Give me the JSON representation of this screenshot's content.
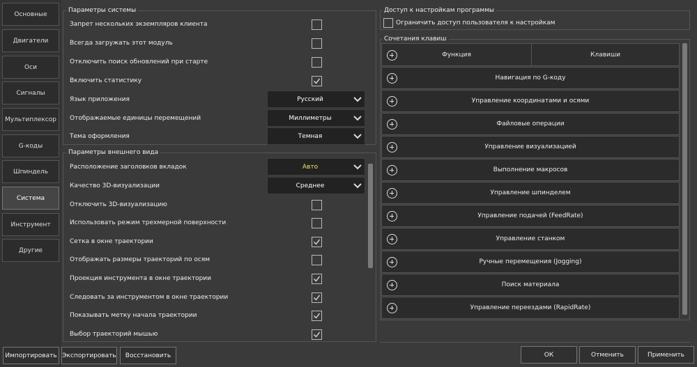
{
  "sidebar": {
    "tabs": [
      "Основные",
      "Двигатели",
      "Оси",
      "Сигналы",
      "Мультиплексор",
      "G-коды",
      "Шпиндель",
      "Система",
      "Инструмент",
      "Другие"
    ],
    "active": "Система"
  },
  "system_params": {
    "title": "Параметры системы",
    "rows": [
      {
        "label": "Запрет нескольких экземпляров клиента",
        "checked": false
      },
      {
        "label": "Всегда загружать этот модуль",
        "checked": false
      },
      {
        "label": "Отключить поиск обновлений при старте",
        "checked": false
      },
      {
        "label": "Включить статистику",
        "checked": true
      }
    ],
    "dropdowns": [
      {
        "label": "Язык приложения",
        "value": "Русский"
      },
      {
        "label": "Отображаемые единицы перемещений",
        "value": "Миллиметры"
      },
      {
        "label": "Тема оформления",
        "value": "Темная"
      }
    ]
  },
  "appearance": {
    "title": "Параметры внешнего вида",
    "dropdowns": [
      {
        "label": "Расположение заголовков вкладок",
        "value": "Авто"
      },
      {
        "label": "Качество 3D-визуализации",
        "value": "Среднее"
      }
    ],
    "rows": [
      {
        "label": "Отключить 3D-визуализацию",
        "checked": false
      },
      {
        "label": "Использовать режим трехмерной поверхности",
        "checked": false
      },
      {
        "label": "Сетка в окне траектории",
        "checked": true
      },
      {
        "label": "Отображать размеры траекторий по осям",
        "checked": false
      },
      {
        "label": "Проекция инструмента в окне траектории",
        "checked": true
      },
      {
        "label": "Следовать за инструментом в окне траектории",
        "checked": true
      },
      {
        "label": "Показывать метку начала траектории",
        "checked": true
      },
      {
        "label": "Выбор траекторий мышью",
        "checked": true
      }
    ]
  },
  "access": {
    "title": "Доступ к настройкам программы",
    "checkbox_label": "Ограничить доступ пользователя к настройкам",
    "checked": false
  },
  "shortcuts": {
    "title": "Сочетания клавиш",
    "header_function": "Функция",
    "header_keys": "Клавиши",
    "groups": [
      "Навигация по G-коду",
      "Управление координатами и осями",
      "Файловые операции",
      "Управление визуализацией",
      "Выполнение макросов",
      "Управление шпинделем",
      "Управление подачей (FeedRate)",
      "Управление станком",
      "Ручные перемещения (Jogging)",
      "Поиск материала",
      "Управление переездами (RapidRate)"
    ]
  },
  "buttons": {
    "import": "Импортировать",
    "export": "Экспортировать",
    "restore": "Восстановить",
    "ok": "ОК",
    "cancel": "Отменить",
    "apply": "Применить"
  },
  "colors": {
    "accent_value": "#f2e36a"
  }
}
